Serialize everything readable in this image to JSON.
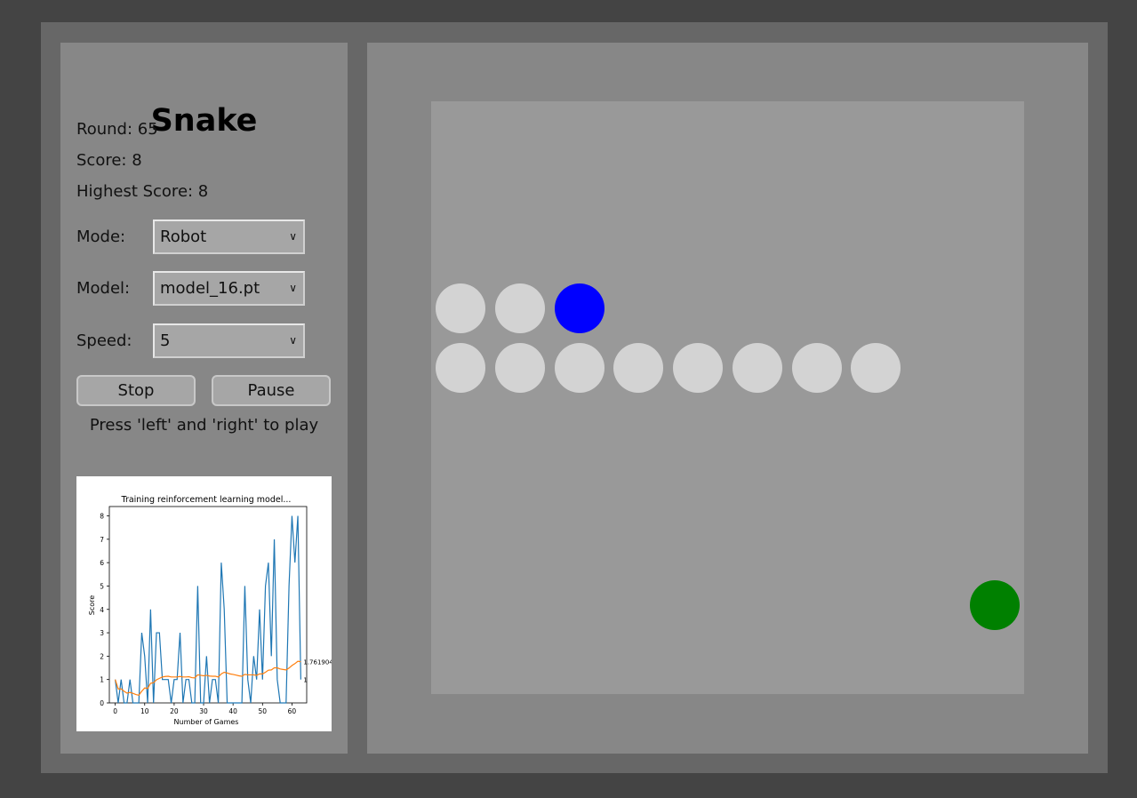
{
  "app": {
    "title": "Snake"
  },
  "stats": {
    "round": "Round: 65",
    "score": "Score: 8",
    "highest": "Highest Score: 8"
  },
  "controls": {
    "mode_label": "Mode:",
    "mode_value": "Robot",
    "model_label": "Model:",
    "model_value": "model_16.pt",
    "speed_label": "Speed:",
    "speed_value": "5",
    "stop_label": "Stop",
    "pause_label": "Pause",
    "hint": "Press 'left' and 'right' to play"
  },
  "colors": {
    "snake_head": "#0000ff",
    "snake_body": "#d3d3d3",
    "food": "#008000",
    "board": "#999999",
    "score_line": "#1f77b4",
    "mean_line": "#ff7f0e"
  },
  "game": {
    "grid_size": 10,
    "head": [
      2,
      3
    ],
    "body": [
      [
        1,
        3
      ],
      [
        0,
        3
      ],
      [
        0,
        4
      ],
      [
        1,
        4
      ],
      [
        2,
        4
      ],
      [
        3,
        4
      ],
      [
        4,
        4
      ],
      [
        5,
        4
      ],
      [
        6,
        4
      ],
      [
        7,
        4
      ]
    ],
    "food": [
      9,
      8
    ]
  },
  "chart_data": {
    "type": "line",
    "title": "Training reinforcement learning model...",
    "xlabel": "Number of Games",
    "ylabel": "Score",
    "xlim": [
      -2,
      65
    ],
    "ylim": [
      0,
      8.4
    ],
    "xticks": [
      0,
      10,
      20,
      30,
      40,
      50,
      60
    ],
    "yticks": [
      0,
      1,
      2,
      3,
      4,
      5,
      6,
      7,
      8
    ],
    "grid": false,
    "series": [
      {
        "values": [
          1,
          0,
          1,
          0,
          0,
          1,
          0,
          0,
          0,
          3,
          2,
          0,
          4,
          0,
          3,
          3,
          1,
          1,
          1,
          0,
          1,
          1,
          3,
          0,
          1,
          1,
          0,
          0,
          5,
          0,
          0,
          2,
          0,
          1,
          1,
          0,
          6,
          4,
          0,
          0,
          0,
          0,
          0,
          0,
          5,
          1,
          0,
          2,
          1,
          4,
          1,
          5,
          6,
          2,
          7,
          1,
          0,
          0,
          0,
          5,
          8,
          6,
          8,
          1
        ],
        "end_label": "1"
      },
      {
        "values": [
          1,
          0.6,
          0.6,
          0.5,
          0.42,
          0.45,
          0.41,
          0.36,
          0.33,
          0.5,
          0.64,
          0.62,
          0.84,
          0.86,
          0.99,
          1.05,
          1.11,
          1.13,
          1.14,
          1.11,
          1.11,
          1.11,
          1.13,
          1.11,
          1.11,
          1.12,
          1.08,
          1.07,
          1.2,
          1.18,
          1.16,
          1.18,
          1.15,
          1.14,
          1.14,
          1.11,
          1.24,
          1.31,
          1.28,
          1.24,
          1.22,
          1.19,
          1.16,
          1.14,
          1.22,
          1.2,
          1.2,
          1.2,
          1.18,
          1.24,
          1.24,
          1.31,
          1.4,
          1.41,
          1.5,
          1.5,
          1.45,
          1.43,
          1.41,
          1.49,
          1.6,
          1.68,
          1.78,
          1.761904
        ],
        "end_label": "1.761904"
      }
    ]
  }
}
